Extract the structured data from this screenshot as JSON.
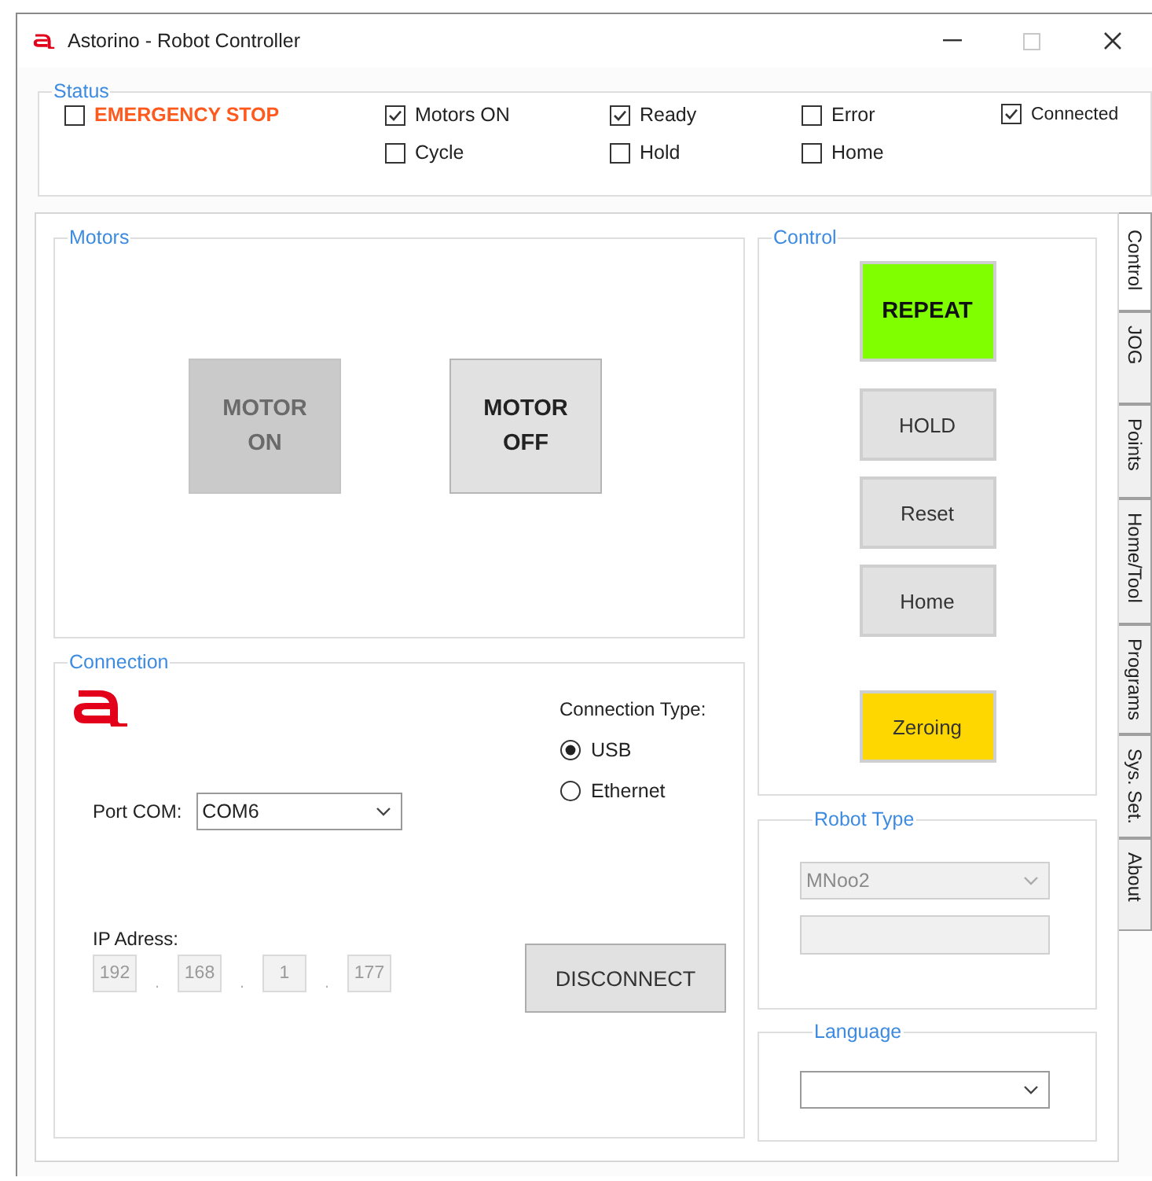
{
  "window": {
    "title": "Astorino - Robot Controller"
  },
  "caption_buttons": [
    {
      "kind": "minimize",
      "disabled": false
    },
    {
      "kind": "maximize",
      "disabled": true
    },
    {
      "kind": "close",
      "disabled": false
    }
  ],
  "status": {
    "title": "Status",
    "columns": [
      [
        {
          "label": "EMERGENCY STOP",
          "checked": false,
          "kind": "alert"
        }
      ],
      [
        {
          "label": "Motors ON",
          "checked": true,
          "kind": "normal"
        },
        {
          "label": "Cycle",
          "checked": false,
          "kind": "normal"
        }
      ],
      [
        {
          "label": "Ready",
          "checked": true,
          "kind": "normal"
        },
        {
          "label": "Hold",
          "checked": false,
          "kind": "normal"
        }
      ],
      [
        {
          "label": "Error",
          "checked": false,
          "kind": "normal"
        },
        {
          "label": "Home",
          "checked": false,
          "kind": "normal"
        }
      ],
      [
        {
          "label": "Connected",
          "checked": true,
          "kind": "small"
        }
      ]
    ]
  },
  "tabs": [
    {
      "label": "Control",
      "selected": true
    },
    {
      "label": "JOG",
      "selected": false
    },
    {
      "label": "Points",
      "selected": false
    },
    {
      "label": "Home/Tool",
      "selected": false
    },
    {
      "label": "Programs",
      "selected": false
    },
    {
      "label": "Sys. Set.",
      "selected": false
    },
    {
      "label": "About",
      "selected": false
    }
  ],
  "motors": {
    "title": "Motors",
    "buttons": [
      {
        "label": "MOTOR ON",
        "disabled": true
      },
      {
        "label": "MOTOR OFF",
        "disabled": false
      }
    ]
  },
  "connection": {
    "title": "Connection",
    "port_label": "Port COM:",
    "port_value": "COM6",
    "type_label": "Connection Type:",
    "types": [
      {
        "label": "USB",
        "selected": true
      },
      {
        "label": "Ethernet",
        "selected": false
      }
    ],
    "ip_label": "IP Adress:",
    "ip_octets": [
      "192",
      "168",
      "1",
      "177"
    ],
    "ip_separator": ".",
    "button": "DISCONNECT"
  },
  "control": {
    "title": "Control",
    "buttons": [
      {
        "label": "REPEAT",
        "color": "#80ff00",
        "bold": true
      },
      {
        "label": "HOLD",
        "color": "#e1e1e1",
        "bold": false
      },
      {
        "label": "Reset",
        "color": "#e1e1e1",
        "bold": false
      },
      {
        "label": "Home",
        "color": "#e1e1e1",
        "bold": false
      },
      {
        "label": "Zeroing",
        "color": "#ffd700",
        "bold": false
      }
    ]
  },
  "robot_type": {
    "title": "Robot Type",
    "value": "MNoo2",
    "disabled": true
  },
  "language": {
    "title": "Language"
  }
}
